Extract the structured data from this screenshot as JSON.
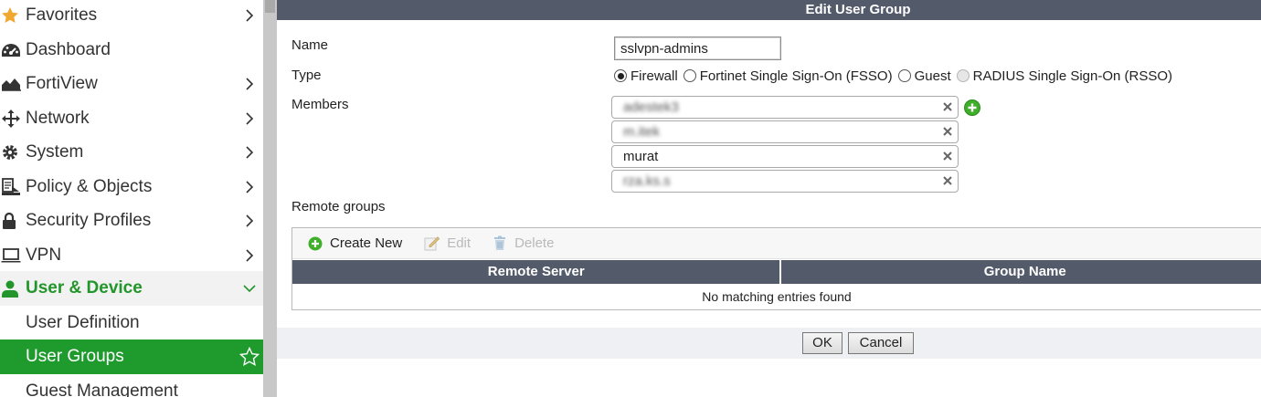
{
  "sidebar": {
    "items": [
      {
        "label": "Favorites",
        "icon": "star-icon"
      },
      {
        "label": "Dashboard",
        "icon": "dashboard-icon"
      },
      {
        "label": "FortiView",
        "icon": "fortiview-icon"
      },
      {
        "label": "Network",
        "icon": "network-icon"
      },
      {
        "label": "System",
        "icon": "gear-icon"
      },
      {
        "label": "Policy & Objects",
        "icon": "policy-icon"
      },
      {
        "label": "Security Profiles",
        "icon": "lock-icon"
      },
      {
        "label": "VPN",
        "icon": "laptop-icon"
      },
      {
        "label": "User & Device",
        "icon": "user-icon"
      },
      {
        "label": "User Definition"
      },
      {
        "label": "User Groups"
      },
      {
        "label": "Guest Management"
      }
    ]
  },
  "dialog": {
    "title": "Edit User Group",
    "name_label": "Name",
    "name_value": "sslvpn-admins",
    "type_label": "Type",
    "type_options": [
      {
        "label": "Firewall",
        "selected": true
      },
      {
        "label": "Fortinet Single Sign-On (FSSO)",
        "selected": false
      },
      {
        "label": "Guest",
        "selected": false
      },
      {
        "label": "RADIUS Single Sign-On (RSSO)",
        "selected": false,
        "disabled": true
      }
    ],
    "members_label": "Members",
    "members": [
      "adestek3",
      "m.itek",
      "murat",
      "rza.ks.s"
    ],
    "remote_groups_label": "Remote groups",
    "toolbar": {
      "create_new": "Create New",
      "edit": "Edit",
      "delete": "Delete"
    },
    "columns": [
      "Remote Server",
      "Group Name"
    ],
    "empty_text": "No matching entries found",
    "ok": "OK",
    "cancel": "Cancel"
  },
  "colors": {
    "header_bg": "#535a6a",
    "active_green": "#1f9b2e",
    "group_green": "#22952b"
  }
}
